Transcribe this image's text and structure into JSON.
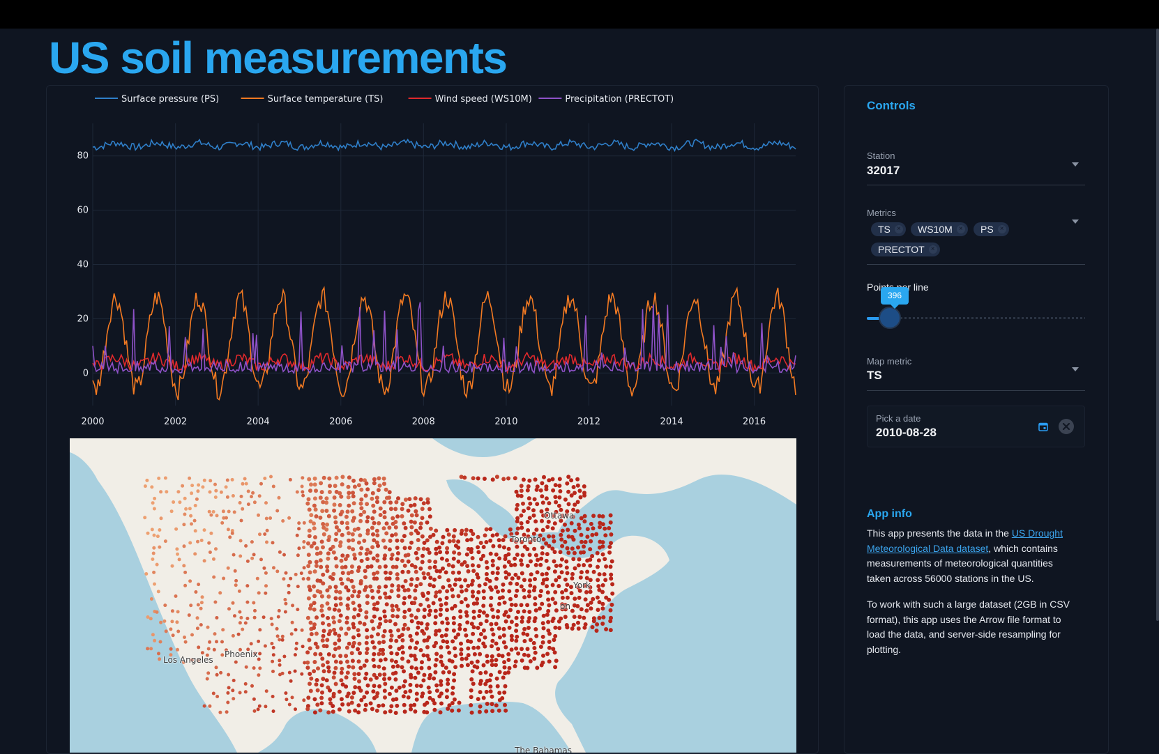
{
  "page": {
    "title": "US soil measurements"
  },
  "chart_data": {
    "type": "line",
    "title": "",
    "xlabel": "",
    "ylabel": "",
    "x_range": [
      "2000-01-01",
      "2017-01-01"
    ],
    "ylim": [
      -12,
      92
    ],
    "grid": true,
    "legend_position": "top",
    "x_ticks": [
      "2000",
      "2002",
      "2004",
      "2006",
      "2008",
      "2010",
      "2012",
      "2014",
      "2016"
    ],
    "y_ticks": [
      "0",
      "20",
      "40",
      "60",
      "80"
    ],
    "series": [
      {
        "name": "Surface pressure (PS)",
        "color": "#2f7fc9",
        "base": 84,
        "amp": 0.8,
        "noise": 1.3,
        "spikes": 0
      },
      {
        "name": "Surface temperature  (TS)",
        "color": "#f37a22",
        "base": 11,
        "amp": 17,
        "noise": 4,
        "spikes": 0
      },
      {
        "name": "Wind speed (WS10M)",
        "color": "#e0292c",
        "base": 4,
        "amp": 1.5,
        "noise": 2.2,
        "spikes": 0
      },
      {
        "name": "Precipitation (PRECTOT)",
        "color": "#8e52c8",
        "base": 1.5,
        "amp": 0,
        "noise": 3,
        "spikes": 1
      }
    ]
  },
  "controls": {
    "title": "Controls",
    "station": {
      "label": "Station",
      "value": "32017"
    },
    "metrics": {
      "label": "Metrics",
      "chips": [
        "TS",
        "WS10M",
        "PS",
        "PRECTOT"
      ]
    },
    "points": {
      "label": "Points per line",
      "value": "396",
      "level": 0.1
    },
    "map_metric": {
      "label": "Map metric",
      "value": "TS"
    },
    "date": {
      "label": "Pick a date",
      "value": "2010-08-28"
    }
  },
  "map": {
    "cities": [
      "Ottawa",
      "Toronto",
      "York",
      "Phoenix",
      "Los Angeles",
      "on",
      "The Bahamas"
    ],
    "colors": {
      "water": "#a9d0df",
      "land": "#f1eee7",
      "dot_low": "#f0a676",
      "dot_high": "#b8261a"
    }
  },
  "app_info": {
    "title": "App info",
    "p1_pre": "This app presents the data in the ",
    "p1_link": "US Drought Meteorological Data dataset",
    "p1_post": ", which contains measurements of meteorological quantities taken across 56000 stations in the US.",
    "p2": "To work with such a large dataset (2GB in CSV format), this app uses the Arrow file format to load the data, and server-side resampling for plotting."
  }
}
